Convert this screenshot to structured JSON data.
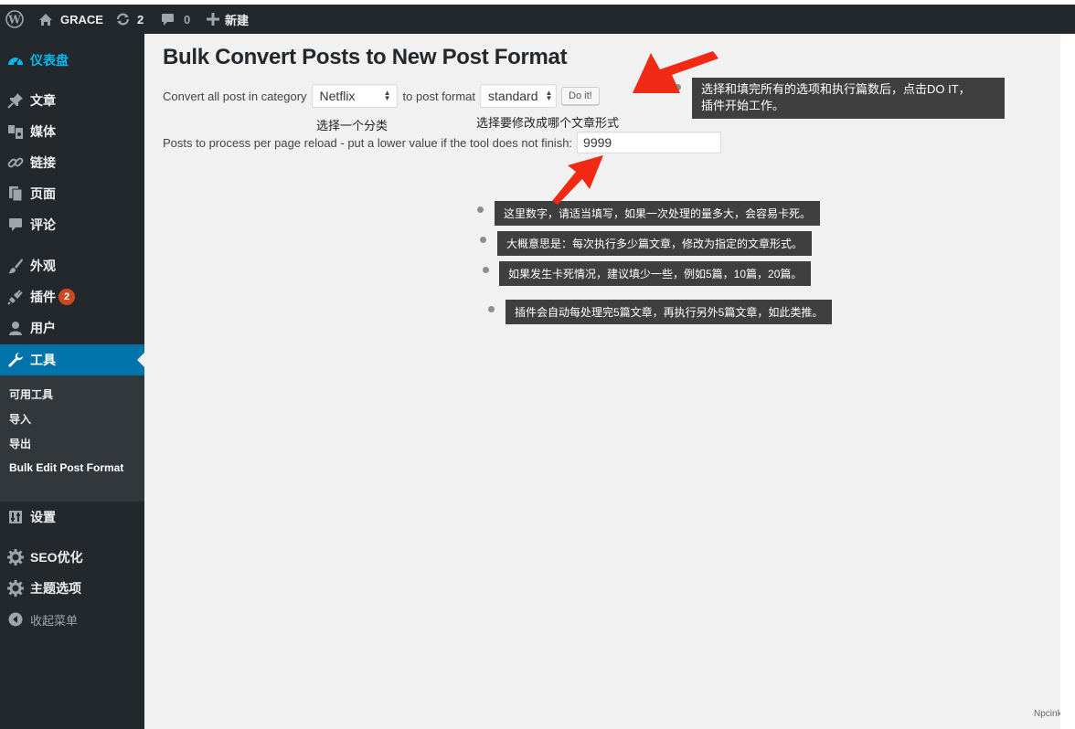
{
  "adminbar": {
    "site_name": "GRACE",
    "updates_count": "2",
    "comments_count": "0",
    "new_label": "新建"
  },
  "sidebar": {
    "dashboard": "仪表盘",
    "posts": "文章",
    "media": "媒体",
    "links": "链接",
    "pages": "页面",
    "comments": "评论",
    "appearance": "外观",
    "plugins": "插件",
    "plugins_badge": "2",
    "users": "用户",
    "tools": "工具",
    "tools_submenu": [
      "可用工具",
      "导入",
      "导出",
      "Bulk Edit Post Format"
    ],
    "settings": "设置",
    "seo": "SEO优化",
    "theme_options": "主题选项",
    "collapse": "收起菜单"
  },
  "main": {
    "title": "Bulk Convert Posts to New Post Format",
    "convert_label": "Convert all post in category",
    "category_value": "Netflix",
    "to_format_label": "to post format",
    "format_value": "standard",
    "do_it_button": "Do it!",
    "per_page_label": "Posts to process per page reload - put a lower value if the tool does not finish:",
    "per_page_value": "9999"
  },
  "annotations": {
    "category_hint": "选择一个分类",
    "format_hint": "选择要修改成哪个文章形式",
    "tip_doit": [
      "选择和填完所有的选项和执行篇数后，点击DO IT，",
      "插件开始工作。"
    ],
    "tip_number": "这里数字，请适当填写，如果一次处理的量多大，会容易卡死。",
    "tip_meaning": "大概意思是：每次执行多少篇文章，修改为指定的文章形式。",
    "tip_freeze": "如果发生卡死情况，建议填少一些，例如5篇，10篇，20篇。",
    "tip_auto": "插件会自动每处理完5篇文章，再执行另外5篇文章，如此类推。"
  },
  "watermark": "Npcink",
  "colors": {
    "adminbar": "#23282d",
    "active_menu": "#0073aa",
    "badge": "#ca4a1f",
    "content_bg": "#f1f1f1",
    "arrow": "#f02a14",
    "tooltip_bg": "#3f3f3f"
  }
}
